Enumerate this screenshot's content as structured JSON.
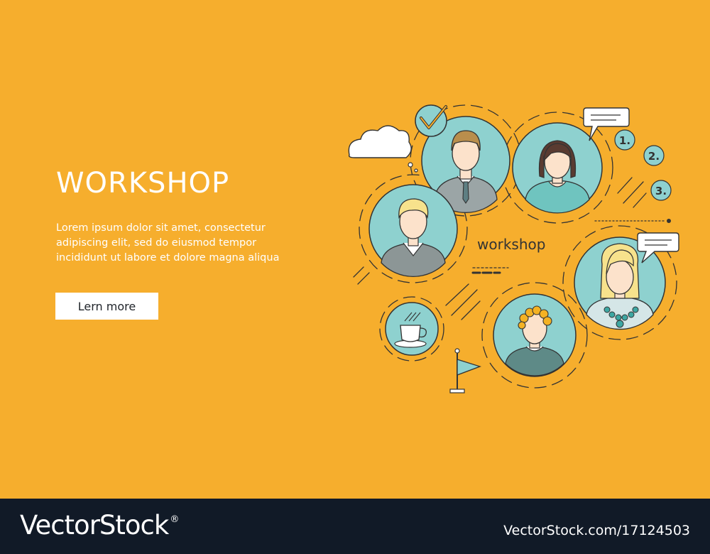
{
  "banner": {
    "title": "WORKSHOP",
    "text_lines": [
      "Lorem ipsum dolor sit amet, consectetur",
      "adipiscing elit, sed do eiusmod tempor",
      "incididunt ut labore et dolore magna aliqua"
    ],
    "cta_label": "Lern more"
  },
  "illustration": {
    "caption": "workshop",
    "steps": [
      "1.",
      "2.",
      "3."
    ],
    "icons": [
      "cloud-icon",
      "checkmark-icon",
      "speech-bubble-icon",
      "coffee-cup-icon",
      "flag-icon"
    ],
    "avatars": [
      "man-with-tie",
      "woman-short-hair",
      "blond-man",
      "woman-with-necklace",
      "curly-haired-person"
    ]
  },
  "footer": {
    "brand": "VectorStock",
    "brand_mark": "®",
    "credit": "VectorStock.com/17124503"
  },
  "colors": {
    "background": "#F6AE2D",
    "avatar_circle": "#8ED1CF",
    "outline": "#333333",
    "footer": "#111A27",
    "button": "#FFFFFF"
  }
}
